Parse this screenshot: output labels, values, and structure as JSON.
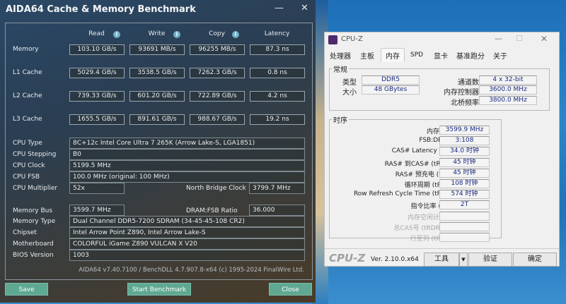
{
  "aida": {
    "title": "AIDA64 Cache & Memory Benchmark",
    "minimize": "—",
    "close_glyph": "✕",
    "columns": [
      "Read",
      "Write",
      "Copy",
      "Latency"
    ],
    "rows": [
      {
        "label": "Memory",
        "values": [
          "103.10 GB/s",
          "93691 MB/s",
          "96255 MB/s",
          "87.3 ns"
        ]
      },
      {
        "label": "L1 Cache",
        "values": [
          "5029.4 GB/s",
          "3538.5 GB/s",
          "7262.3 GB/s",
          "0.8 ns"
        ]
      },
      {
        "label": "L2 Cache",
        "values": [
          "739.33 GB/s",
          "601.20 GB/s",
          "722.89 GB/s",
          "4.2 ns"
        ]
      },
      {
        "label": "L3 Cache",
        "values": [
          "1655.5 GB/s",
          "891.61 GB/s",
          "988.67 GB/s",
          "19.2 ns"
        ]
      }
    ],
    "info": {
      "cpu_type_label": "CPU Type",
      "cpu_type": "8C+12c Intel Core Ultra 7 265K  (Arrow Lake-S, LGA1851)",
      "cpu_stepping_label": "CPU Stepping",
      "cpu_stepping": "B0",
      "cpu_clock_label": "CPU Clock",
      "cpu_clock": "5199.5 MHz",
      "cpu_fsb_label": "CPU FSB",
      "cpu_fsb": "100.0 MHz  (original: 100 MHz)",
      "cpu_mult_label": "CPU Multiplier",
      "cpu_mult": "52x",
      "nb_clock_label": "North Bridge Clock",
      "nb_clock": "3799.7 MHz",
      "mem_bus_label": "Memory Bus",
      "mem_bus": "3599.7 MHz",
      "dram_fsb_label": "DRAM:FSB Ratio",
      "dram_fsb": "36.000",
      "mem_type_label": "Memory Type",
      "mem_type": "Dual Channel DDR5-7200 SDRAM  (34-45-45-108 CR2)",
      "chipset_label": "Chipset",
      "chipset": "Intel Arrow Point Z890, Intel Arrow Lake-S",
      "mobo_label": "Motherboard",
      "mobo": "COLORFUL iGame Z890 VULCAN X V20",
      "bios_label": "BIOS Version",
      "bios": "1003"
    },
    "footer": "AIDA64 v7.40.7100 / BenchDLL 4.7.907.8-x64  (c) 1995-2024 FinalWire Ltd.",
    "buttons": {
      "save": "Save",
      "start": "Start Benchmark",
      "close": "Close"
    }
  },
  "cpuz": {
    "title": "CPU-Z",
    "tabs": [
      "处理器",
      "主板",
      "内存",
      "SPD",
      "显卡",
      "基准跑分",
      "关于"
    ],
    "general": {
      "title": "常规",
      "type_label": "类型",
      "type": "DDR5",
      "size_label": "大小",
      "size": "48 GBytes",
      "channels_label": "通道数",
      "channels": "4 x 32-bit",
      "mc_label": "内存控制器",
      "mc": "3600.0 MHz",
      "nb_label": "北桥频率",
      "nb": "3800.0 MHz"
    },
    "timings": {
      "title": "时序",
      "rows": [
        {
          "label": "内存频率",
          "value": "3599.9 MHz"
        },
        {
          "label": "FSB:DRAM",
          "value": "3:108"
        },
        {
          "label": "CAS# Latency (CL)",
          "value": "34.0 时钟"
        },
        {
          "label": "RAS# 到CAS# (tRCD)",
          "value": "45 时钟"
        },
        {
          "label": "RAS# 预充电 (tRP)",
          "value": "45 时钟"
        },
        {
          "label": "循环周期 (tRAS)",
          "value": "108 时钟"
        },
        {
          "label": "Row Refresh Cycle Time (tRFC)",
          "value": "574 时钟"
        },
        {
          "label": "指令比率 (CR)",
          "value": "2T"
        },
        {
          "label": "内存空闲计时器",
          "value": ""
        },
        {
          "label": "总CAS号 (tRDRAM)",
          "value": ""
        },
        {
          "label": "行至列 (tRCD)",
          "value": ""
        }
      ]
    },
    "footer": {
      "logo": "CPU-Z",
      "version": "Ver. 2.10.0.x64",
      "tools": "工具",
      "validate": "验证",
      "ok": "确定"
    }
  }
}
